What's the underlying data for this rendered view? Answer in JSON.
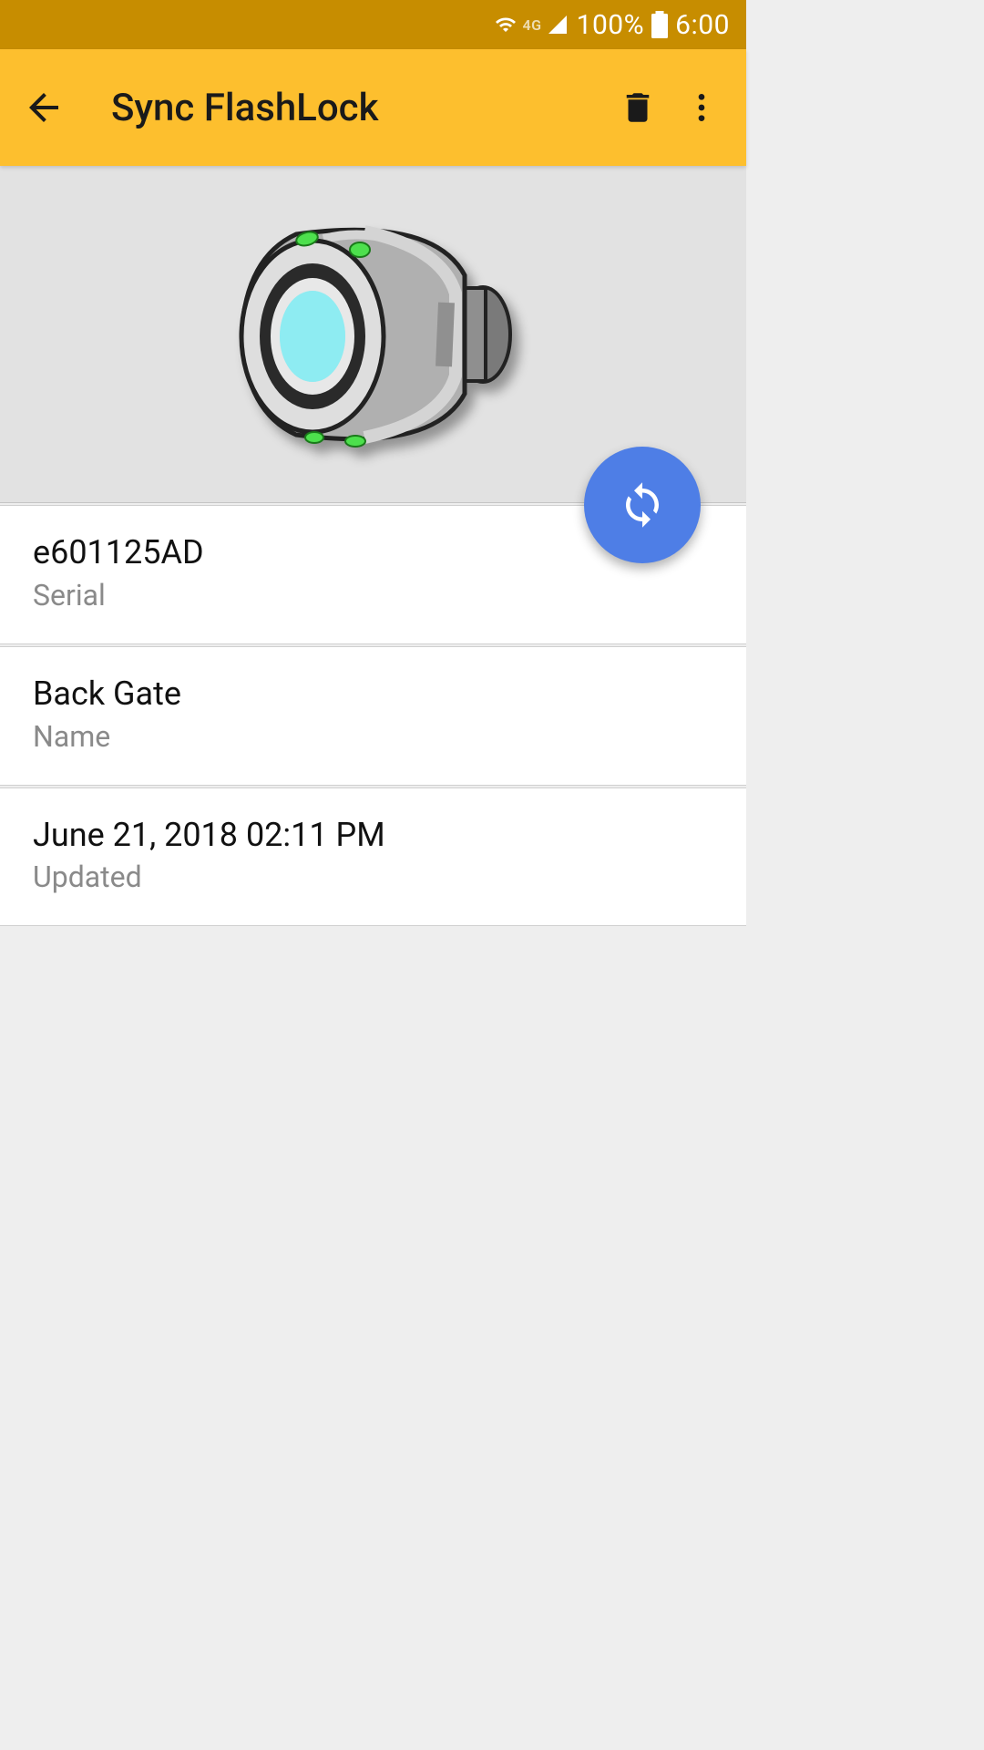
{
  "status": {
    "battery": "100%",
    "time": "6:00",
    "network": "4G"
  },
  "appbar": {
    "title": "Sync FlashLock"
  },
  "details": {
    "serial": {
      "value": "e601125AD",
      "label": "Serial"
    },
    "name": {
      "value": "Back Gate",
      "label": "Name"
    },
    "updated": {
      "value": "June 21, 2018 02:11 PM",
      "label": "Updated"
    }
  }
}
